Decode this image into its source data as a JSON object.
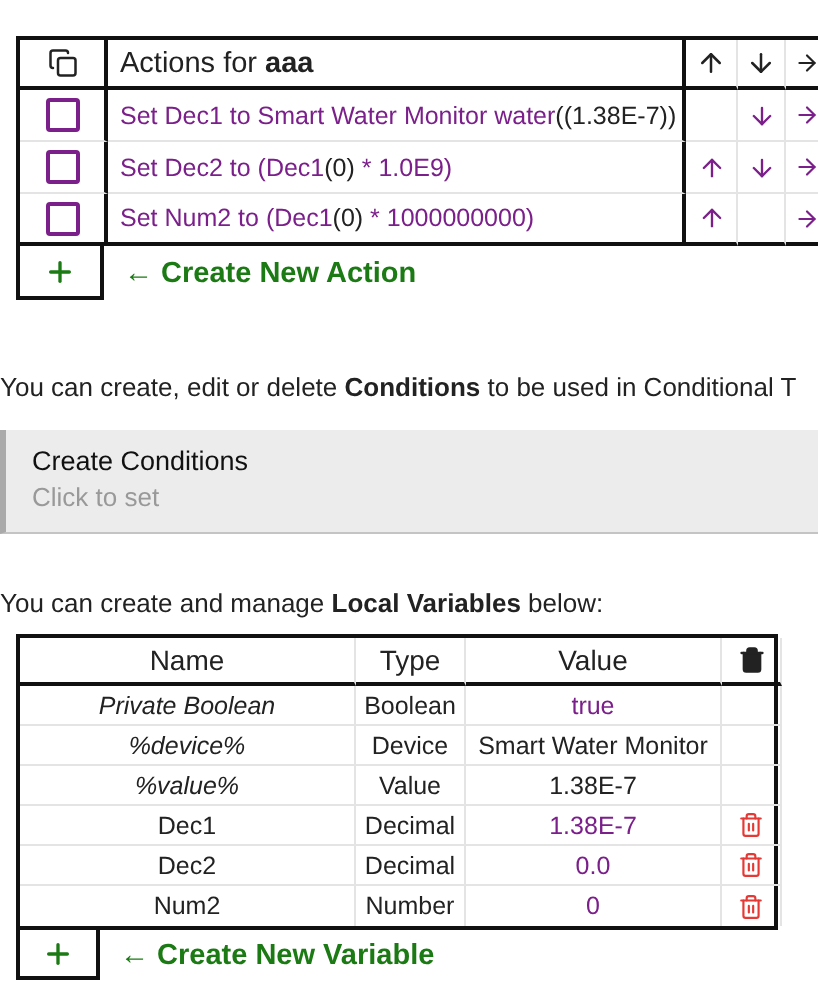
{
  "actions_table": {
    "title_prefix": "Actions for ",
    "title_name": "aaa",
    "actions": [
      {
        "checked": false,
        "can_move_up": false,
        "can_move_down": true,
        "segments": [
          {
            "text": "Set Dec1 to Smart Water Monitor water",
            "linked": true
          },
          {
            "text": "((1.38E-7))",
            "linked": false
          }
        ]
      },
      {
        "checked": false,
        "can_move_up": true,
        "can_move_down": true,
        "segments": [
          {
            "text": "Set Dec2 to (Dec1",
            "linked": true
          },
          {
            "text": "(0)",
            "linked": false
          },
          {
            "text": " * 1.0E9)",
            "linked": true
          }
        ]
      },
      {
        "checked": false,
        "can_move_up": true,
        "can_move_down": false,
        "segments": [
          {
            "text": "Set Num2 to (Dec1",
            "linked": true
          },
          {
            "text": "(0)",
            "linked": false
          },
          {
            "text": " * 1000000000)",
            "linked": true
          }
        ]
      }
    ],
    "create_link": "← Create New Action"
  },
  "conditions_note": "You can create, edit or delete **Conditions** to be used in Conditional T",
  "conditions_card": {
    "title": "Create Conditions",
    "subtitle": "Click to set"
  },
  "variables_note": "You can create and manage **Local Variables** below:",
  "variables_table": {
    "columns": [
      "Name",
      "Type",
      "Value"
    ],
    "rows": [
      {
        "name": "Private Boolean",
        "kind": "system",
        "type": "Boolean",
        "value": "true",
        "linked": true,
        "deletable": false
      },
      {
        "name": "%device%",
        "kind": "system",
        "type": "Device",
        "value": "Smart Water Monitor",
        "linked": false,
        "deletable": false
      },
      {
        "name": "%value%",
        "kind": "system",
        "type": "Value",
        "value": "1.38E-7",
        "linked": false,
        "deletable": false
      },
      {
        "name": "Dec1",
        "kind": "user",
        "type": "Decimal",
        "value": "1.38E-7",
        "linked": true,
        "deletable": true
      },
      {
        "name": "Dec2",
        "kind": "user",
        "type": "Decimal",
        "value": "0.0",
        "linked": true,
        "deletable": true
      },
      {
        "name": "Num2",
        "kind": "user",
        "type": "Number",
        "value": "0",
        "linked": true,
        "deletable": true
      }
    ],
    "create_link": "← Create New Variable"
  }
}
